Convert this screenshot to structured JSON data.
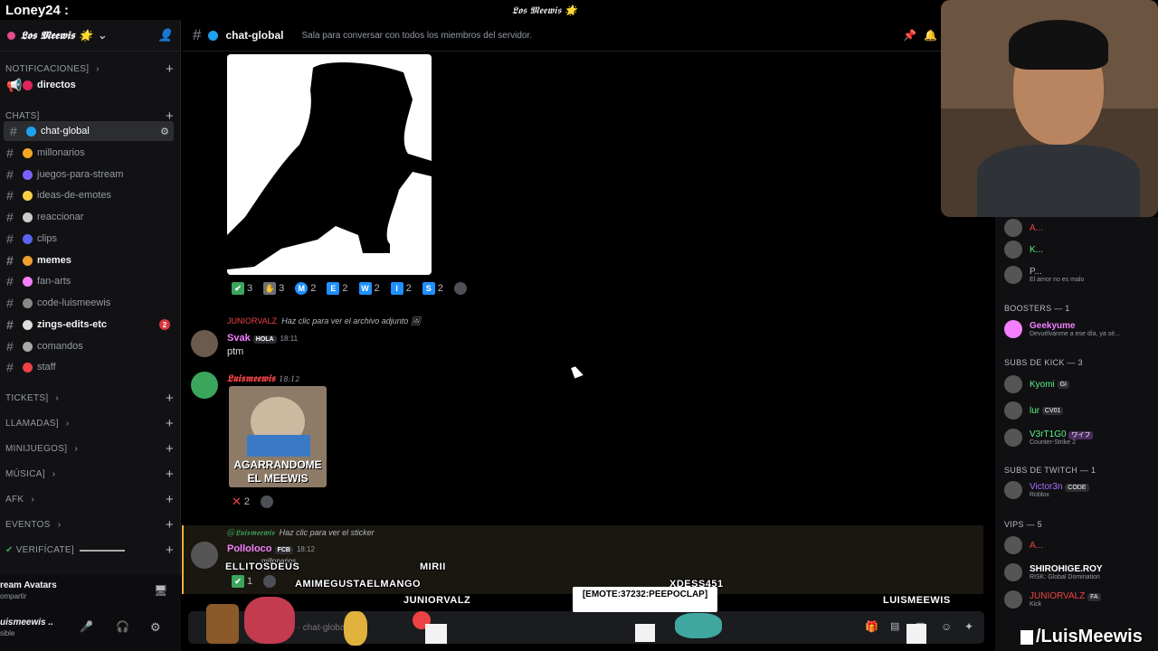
{
  "stream": {
    "user": "Loney24 :",
    "server_title": "𝕷𝖔𝖘 𝕸𝖊𝖊𝖜𝖎𝖘 🌟"
  },
  "server": {
    "name": "𝕷𝖔𝖘 𝕸𝖊𝖊𝖜𝖎𝖘 🌟"
  },
  "sidebar": {
    "categories": [
      {
        "label": "NOTIFICACIONES]"
      },
      {
        "label": "CHATS]"
      },
      {
        "label": "TICKETS]"
      },
      {
        "label": "LLAMADAS]"
      },
      {
        "label": "MINIJUEGOS]"
      },
      {
        "label": "MÚSICA]"
      },
      {
        "label": "AFK"
      },
      {
        "label": "EVENTOS"
      },
      {
        "label": "VERIFÍCATE]"
      }
    ],
    "channels": [
      {
        "label": "directos",
        "color": "#e0245e"
      },
      {
        "label": "chat-global",
        "color": "#1da1f2"
      },
      {
        "label": "millonarios",
        "color": "#f5a623"
      },
      {
        "label": "juegos-para-stream",
        "color": "#7b61ff"
      },
      {
        "label": "ideas-de-emotes",
        "color": "#f7d046"
      },
      {
        "label": "reaccionar",
        "color": "#cccccc"
      },
      {
        "label": "clips",
        "color": "#5865f2"
      },
      {
        "label": "memes",
        "color": "#f0a030"
      },
      {
        "label": "fan-arts",
        "color": "#f47fff"
      },
      {
        "label": "code-luismeewis",
        "color": "#888888"
      },
      {
        "label": "zings-edits-etc",
        "color": "#dddddd"
      },
      {
        "label": "comandos",
        "color": "#aaaaaa"
      },
      {
        "label": "staff",
        "color": "#ed4245"
      }
    ],
    "unread_count": "2",
    "panel_title": "ream Avatars",
    "panel_sub": "ompartir",
    "panel_user": "uismeewis ..",
    "panel_status": "sible"
  },
  "topbar": {
    "channel": "chat-global",
    "topic": "Sala para conversar con todos los miembros del servidor."
  },
  "messages": {
    "reactions_1": [
      {
        "emoji": "✔",
        "count": "3",
        "color": "#3ba55c"
      },
      {
        "emoji": "✋",
        "count": "3",
        "color": "#6d6f78"
      },
      {
        "emoji": "M",
        "count": "2",
        "color": "#1e90ff"
      },
      {
        "emoji": "E",
        "count": "2",
        "color": "#1e90ff"
      },
      {
        "emoji": "W",
        "count": "2",
        "color": "#1e90ff"
      },
      {
        "emoji": "I",
        "count": "2",
        "color": "#1e90ff"
      },
      {
        "emoji": "S",
        "count": "2",
        "color": "#1e90ff"
      }
    ],
    "m2": {
      "reply_user": "JUNIORVALZ",
      "reply_text": "Haz clic para ver el archivo adjunto",
      "user": "Svak",
      "tag": "HOLA",
      "time": "18:11",
      "text": "ptm"
    },
    "m3": {
      "user": "𝕷𝖚𝖎𝖘𝖒𝖊𝖊𝖜𝖎𝖘",
      "time": "18:12",
      "caption_1": "AGARRANDOME",
      "caption_2": "EL MEEWIS",
      "reaction_count": "2"
    },
    "m4": {
      "reply_user": "@𝕷𝖚𝖎𝖘𝖒𝖊𝖊𝖜𝖎𝖘",
      "reply_text": "Haz clic para ver el sticker",
      "user": "Polloloco",
      "tag": "FCB",
      "time": "18:12",
      "sub": "millonarios",
      "reaction_count": "1"
    }
  },
  "composer": {
    "placeholder": "saje a #  · chat-global"
  },
  "members": [
    {
      "name": "A...",
      "color": "#ed4245"
    },
    {
      "name": "K...",
      "color": "#57f287"
    },
    {
      "name": "P...",
      "color": "#b5bac1",
      "sub": "El amor no es malo"
    },
    {
      "group": "BOOSTERS — 1"
    },
    {
      "name": "Geekyume",
      "color": "#f47fff",
      "sub": "Devuélvanme a ese día, ya sé..."
    },
    {
      "group": "SUBS DE KICK — 3"
    },
    {
      "name": "Kyomi",
      "color": "#57f287",
      "tag": "GI"
    },
    {
      "name": "lur",
      "color": "#57f287",
      "tag": "CV01"
    },
    {
      "name": "V3rT1G0",
      "color": "#57f287",
      "tag": "ワイフ",
      "sub": "Counter-Strike 2"
    },
    {
      "group": "SUBS DE TWITCH — 1"
    },
    {
      "name": "Victor3n",
      "color": "#a970ff",
      "tag": "CODE",
      "sub": "Roblox"
    },
    {
      "group": "VIPS — 5"
    },
    {
      "name": "A...",
      "color": "#ed4245"
    },
    {
      "name": "SHIROHIGE.ROY",
      "color": "#ffffff",
      "sub": "RISK: Global Domination"
    },
    {
      "name": "JUNIORVALZ",
      "color": "#ed4245",
      "tag": "FA",
      "sub": "Kick"
    }
  ],
  "overlay": {
    "names": [
      "ELLITOSDEUS",
      "AMIMEGUSTAELMANGO",
      "MIRII",
      "JUNIORVALZ",
      "XDESS451",
      "LUISMEEWIS"
    ],
    "emote_popup": "[EMOTE:37232:PEEPOCLAP]",
    "watermark": "/LuisMeewis"
  }
}
